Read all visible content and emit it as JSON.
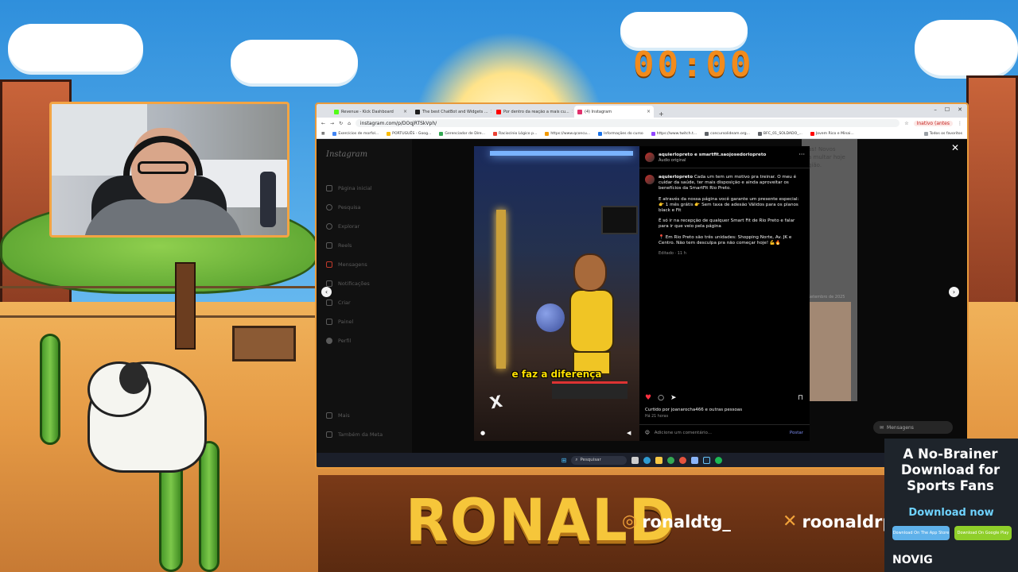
{
  "stream": {
    "timer": "00:00",
    "streamer_name": "RONALD",
    "socials": [
      {
        "icon": "instagram-icon",
        "handle": "ronaldtg_"
      },
      {
        "icon": "x-icon",
        "handle": "roonaldrp"
      }
    ]
  },
  "ad": {
    "title": "A No-Brainer Download for Sports Fans",
    "cta": "Download now",
    "app_store": "Download On The App Store",
    "google_play": "Download On Google Play",
    "brand": "NOVIG"
  },
  "browser": {
    "tabs": [
      {
        "label": "Revenue - Kick Dashboard",
        "color": "#53fc18"
      },
      {
        "label": "The best ChatBot and Widgets ...",
        "color": "#1e1e1e"
      },
      {
        "label": "Por dentro da reação a mais cu...",
        "color": "#ff0000"
      },
      {
        "label": "(4) Instagram",
        "color": "#e1306c"
      }
    ],
    "url": "instagram.com/p/DOqjRTSkVph/",
    "profile_warning": "Inativo (antes",
    "bookmarks": [
      "Exercícios de morfol...",
      "PORTUGUÊS - Goog...",
      "Gerenciador de Dire...",
      "Raciocínio Lógico p...",
      "https://www.qconcu...",
      "Informações do curso",
      "https://www.twitch.t...",
      "concursolideam.org...",
      "BFC_01_SOLDADO_...",
      "Jovem Rico e Minai..."
    ],
    "all_favorites": "Todos os favoritos"
  },
  "instagram": {
    "logo": "Instagram",
    "nav": [
      "Página inicial",
      "Pesquisa",
      "Explorar",
      "Reels",
      "Mensagens",
      "Notificações",
      "Criar",
      "Painel",
      "Perfil"
    ],
    "nav_bottom": [
      "Mais",
      "Também da Meta"
    ],
    "feed_text": "as! Novos\na multar hoje\ngião.",
    "feed_date": "Setembro de 2025",
    "reel_caption": "e faz a diferença",
    "post": {
      "header_user": "aquierlopreto e smartfit.saojosedoriopreto",
      "audio": "Áudio original",
      "author": "aquierlopreto",
      "lines": [
        "Cada um tem um motivo pra treinar. O meu é cuidar da saúde, ter mais disposição e ainda aproveitar os benefícios da SmartFit Rio Preto.",
        "E através da nossa página você garante um presente especial: 👉 1 mês grátis 👉 Sem taxa de adesão Válidos para os planos black e Fit",
        "É só ir na recepção de qualquer Smart Fit de Rio Preto e falar para ir que veio pela página",
        "📍 Em Rio Preto são três unidades: Shopping Norte, Av. JK e Centro. Não tem desculpa pra não começar hoje! 💪🔥"
      ],
      "edited": "Editado · 11 h",
      "likes": "Curtido por joanarocha466 e outras pessoas",
      "time": "Há 21 horas",
      "comment_placeholder": "Adicione um comentário...",
      "post_button": "Postar"
    },
    "messages": "Mensagens"
  },
  "taskbar": {
    "search": "Pesquisar"
  }
}
